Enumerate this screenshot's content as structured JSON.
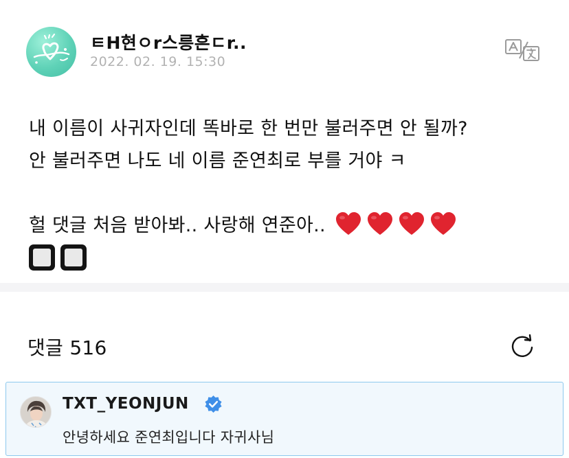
{
  "post": {
    "author": "ㅌH현ㅇr스릉흔ㄷr..",
    "date": "2022. 02. 19. 15:30",
    "lines": [
      "내 이름이 사귀자인데 똑바로 한 번만 불러주면 안 될까?",
      "안 불러주면 나도 네 이름 준연최로 부를 거야 ㅋ",
      "헐 댓글 처음 받아봐.. 사랑해 연준아.."
    ],
    "hearts_count": 4,
    "boxes_count": 2
  },
  "icons": {
    "translate": "translate-icon",
    "refresh": "refresh-icon",
    "heart": "red-heart-icon",
    "verified": "verified-badge-icon"
  },
  "comments": {
    "label": "댓글 516"
  },
  "featured_comment": {
    "author": "TXT_YEONJUN",
    "text": "안녕하세요 준연최입니다 자귀사님"
  },
  "colors": {
    "avatar_bg": "#5fd2b7",
    "heart": "#e0242f",
    "verified": "#3f8fe8",
    "card_bg": "#f1f8fd",
    "card_border": "#8cc8ee",
    "date": "#b2b2b2"
  }
}
